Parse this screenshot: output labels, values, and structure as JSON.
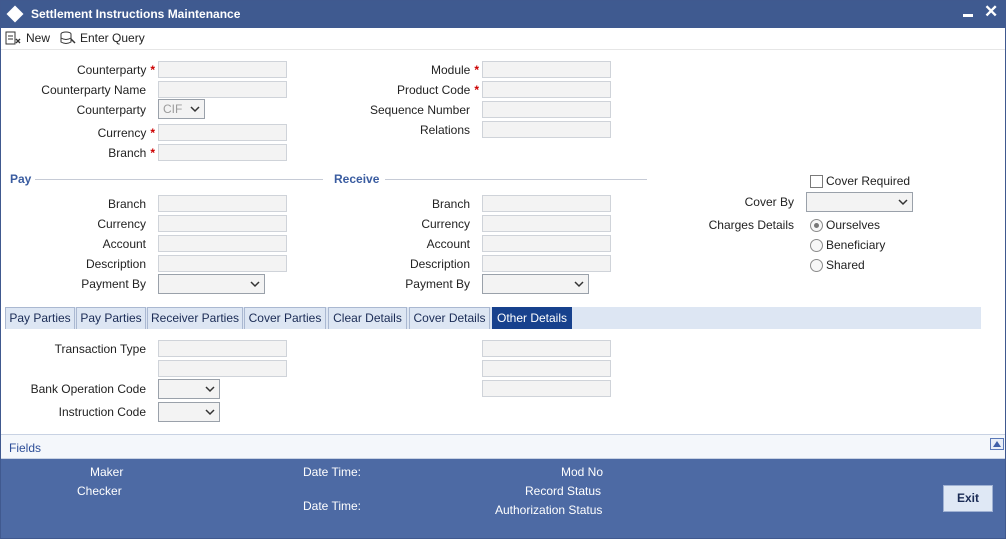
{
  "window": {
    "title": "Settlement Instructions Maintenance"
  },
  "toolbar": {
    "new_label": "New",
    "enter_query_label": "Enter Query"
  },
  "header_left": {
    "counterparty_label": "Counterparty",
    "counterparty_name_label": "Counterparty Name",
    "counterparty_type_label": "Counterparty",
    "counterparty_type_value": "CIF",
    "currency_label": "Currency",
    "branch_label": "Branch"
  },
  "header_right": {
    "module_label": "Module",
    "product_code_label": "Product Code",
    "sequence_number_label": "Sequence Number",
    "relations_label": "Relations"
  },
  "required_mark": "*",
  "pay": {
    "title": "Pay",
    "branch_label": "Branch",
    "currency_label": "Currency",
    "account_label": "Account",
    "description_label": "Description",
    "payment_by_label": "Payment By"
  },
  "receive": {
    "title": "Receive",
    "branch_label": "Branch",
    "currency_label": "Currency",
    "account_label": "Account",
    "description_label": "Description",
    "payment_by_label": "Payment By"
  },
  "cover": {
    "cover_required_label": "Cover Required",
    "cover_required_checked": false,
    "cover_by_label": "Cover By",
    "charges_details_label": "Charges Details",
    "options": [
      {
        "label": "Ourselves",
        "selected": true
      },
      {
        "label": "Beneficiary",
        "selected": false
      },
      {
        "label": "Shared",
        "selected": false
      }
    ]
  },
  "tabs": [
    {
      "label": "Pay Parties",
      "active": false
    },
    {
      "label": "Pay Parties",
      "active": false
    },
    {
      "label": "Receiver Parties",
      "active": false
    },
    {
      "label": "Cover Parties",
      "active": false
    },
    {
      "label": "Clear Details",
      "active": false
    },
    {
      "label": "Cover Details",
      "active": false
    },
    {
      "label": "Other Details",
      "active": true
    }
  ],
  "other_details": {
    "transaction_type_label": "Transaction Type",
    "bank_operation_code_label": "Bank Operation Code",
    "instruction_code_label": "Instruction Code"
  },
  "fields_bar": {
    "label": "Fields"
  },
  "audit": {
    "maker_label": "Maker",
    "checker_label": "Checker",
    "date_time_label_1": "Date Time:",
    "date_time_label_2": "Date Time:",
    "mod_no_label": "Mod No",
    "record_status_label": "Record Status",
    "authorization_status_label": "Authorization Status",
    "exit_label": "Exit"
  },
  "colors": {
    "title_bar": "#3f5a90",
    "audit_bar": "#4d6aa4",
    "active_tab": "#17418d",
    "section_label": "#3a5ca0",
    "required": "#cc0000"
  },
  "icons": {
    "logo": "diamond-logo-icon",
    "minimize": "minimize-icon",
    "close": "close-icon",
    "new": "new-document-icon",
    "enter_query": "enter-query-icon",
    "dropdown": "chevron-down-icon",
    "collapse": "collapse-up-icon"
  }
}
